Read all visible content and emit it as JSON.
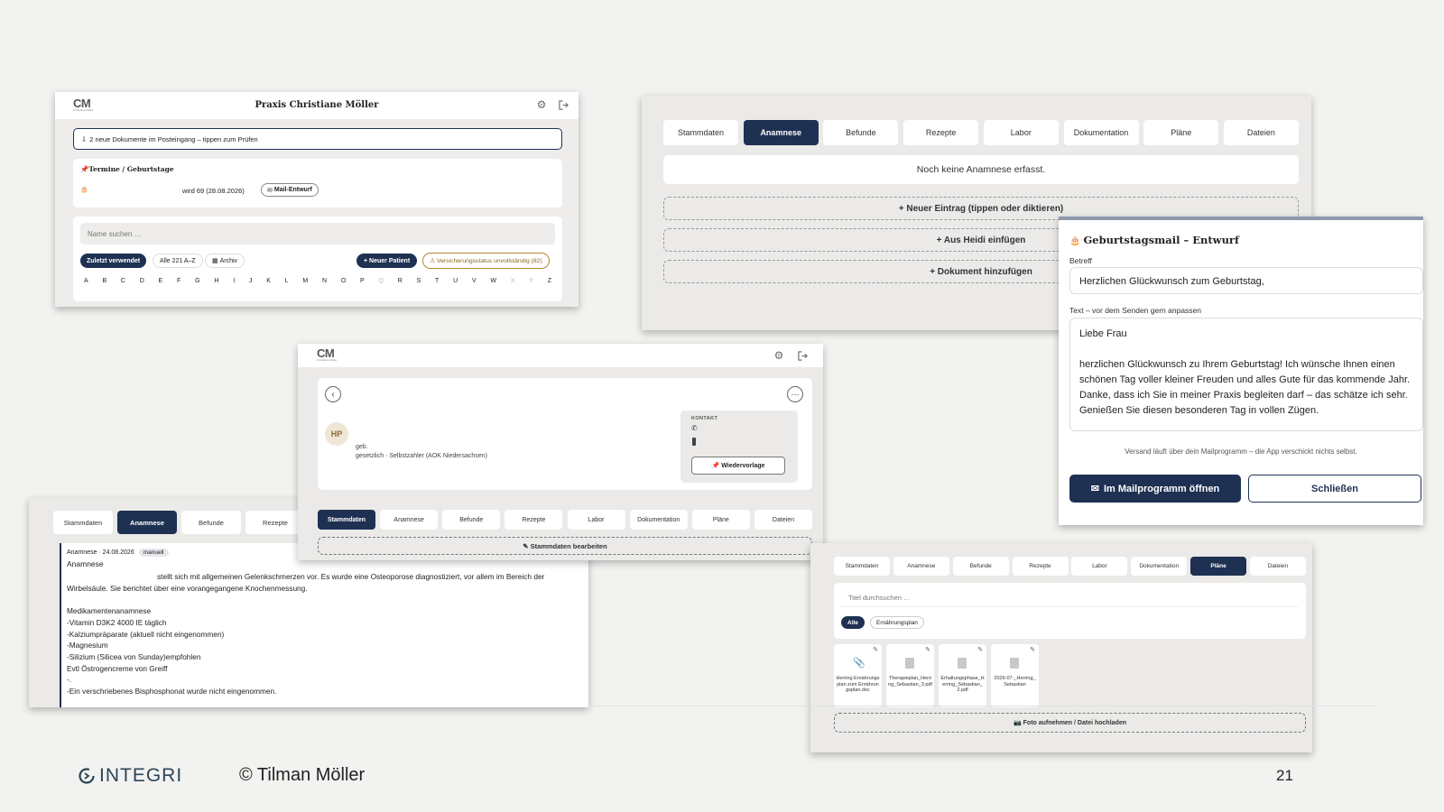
{
  "s1": {
    "logo": "CM",
    "logo_sub": "Christiane Möller",
    "title": "Praxis Christiane Möller",
    "inbox_notice": "2 neue Dokumente im Posteingang – tippen zum Prüfen",
    "birthdays_heading": "Termine / Geburtstage",
    "birthday_text": "wird 69 (28.08.2026)",
    "mail_draft": "Mail-Entwurf",
    "search_placeholder": "Name suchen …",
    "filter_recent": "Zuletzt verwendet",
    "filter_all": "Alle 221 A–Z",
    "filter_archive": "Archiv",
    "new_patient": "+ Neuer Patient",
    "insurance_warning": "Versicherungsstatus unvollständig (82)",
    "letters": [
      "A",
      "B",
      "C",
      "D",
      "E",
      "F",
      "G",
      "H",
      "I",
      "J",
      "K",
      "L",
      "M",
      "N",
      "O",
      "P",
      "Q",
      "R",
      "S",
      "T",
      "U",
      "V",
      "W",
      "X",
      "Y",
      "Z"
    ],
    "dim_letters": [
      "Q",
      "X",
      "Y"
    ]
  },
  "s2": {
    "tabs": [
      "Stammdaten",
      "Anamnese",
      "Befunde",
      "Rezepte",
      "Labor",
      "Dokumentation",
      "Pläne",
      "Dateien"
    ],
    "active": 1,
    "empty": "Noch keine Anamnese erfasst.",
    "actions": [
      "+ Neuer Eintrag (tippen oder diktieren)",
      "+ Aus Heidi einfügen",
      "+ Dokument hinzufügen"
    ]
  },
  "s3": {
    "tabs": [
      "Stammdaten",
      "Anamnese",
      "Befunde",
      "Rezepte"
    ],
    "active": 1,
    "entry_meta": "Anamnese · 24.08.2026",
    "entry_badge": "manuell",
    "heading": "Anamnese",
    "lines": [
      "stellt sich mit allgemeinen Gelenkschmerzen vor. Es wurde eine Osteoporose diagnostiziert, vor allem im Bereich der",
      "Wirbelsäule. Sie berichtet über eine vorangegangene Knochenmessung.",
      "",
      "Medikamentenanamnese",
      "-Vitamin D3K2 4000 IE täglich",
      "-Kalziumpräparate (aktuell nicht eingenommen)",
      "-Magnesium",
      "-Silizium (Silicea von Sunday)empfohlen",
      "Evtl Östrogencreme von Greiff",
      "-.",
      "-Ein verschriebenes Bisphosphonat wurde nicht eingenommen."
    ]
  },
  "s4": {
    "logo": "CM",
    "logo_sub": "Christiane Möller",
    "initials": "HP",
    "born_label": "geb.",
    "insurance": "gesetzlich · Selbstzahler (AOK Niedersachsen)",
    "contact_label": "KONTAKT",
    "followup": "Wiedervorlage",
    "tabs": [
      "Stammdaten",
      "Anamnese",
      "Befunde",
      "Rezepte",
      "Labor",
      "Dokumentation",
      "Pläne",
      "Dateien"
    ],
    "active": 0,
    "edit": "✎ Stammdaten bearbeiten"
  },
  "s5": {
    "title": "Geburtstagsmail – Entwurf",
    "subject_label": "Betreff",
    "subject_value": "Herzlichen Glückwunsch zum Geburtstag,",
    "text_label": "Text – vor dem Senden gern anpassen",
    "body": "Liebe Frau\n\nherzlichen Glückwunsch zu Ihrem Geburtstag! Ich wünsche Ihnen einen schönen Tag voller kleiner Freuden und alles Gute für das kommende Jahr. Danke, dass ich Sie in meiner Praxis begleiten darf – das schätze ich sehr. Genießen Sie diesen besonderen Tag in vollen Zügen.",
    "note": "Versand läuft über dein Mailprogramm – die App verschickt nichts selbst.",
    "open_mail": "Im Mailprogramm öffnen",
    "close": "Schließen"
  },
  "s6": {
    "tabs": [
      "Stammdaten",
      "Anamnese",
      "Befunde",
      "Rezepte",
      "Labor",
      "Dokumentation",
      "Pläne",
      "Dateien"
    ],
    "active": 6,
    "search_placeholder": "Titel durchsuchen …",
    "filters": [
      "Alle",
      "Ernährungsplan"
    ],
    "files": [
      {
        "name": "Herring Ernährungsplan zum Ernährungsplan.doc"
      },
      {
        "name": "Therapieplan_Herring_Sebastian_3.pdf"
      },
      {
        "name": "Erhaltungsphase_Herring_Sebastian_2.pdf"
      },
      {
        "name": "2026-07-_Herring_Sebastian"
      }
    ],
    "upload": "📷 Foto aufnehmen / Datei hochladen"
  },
  "footer": {
    "brand": "INTEGRI",
    "copyright": "© Tilman Möller",
    "page": "21"
  },
  "colors": {
    "navy": "#1f3152",
    "panel": "#ebeae8",
    "warning": "#b08a2c"
  }
}
